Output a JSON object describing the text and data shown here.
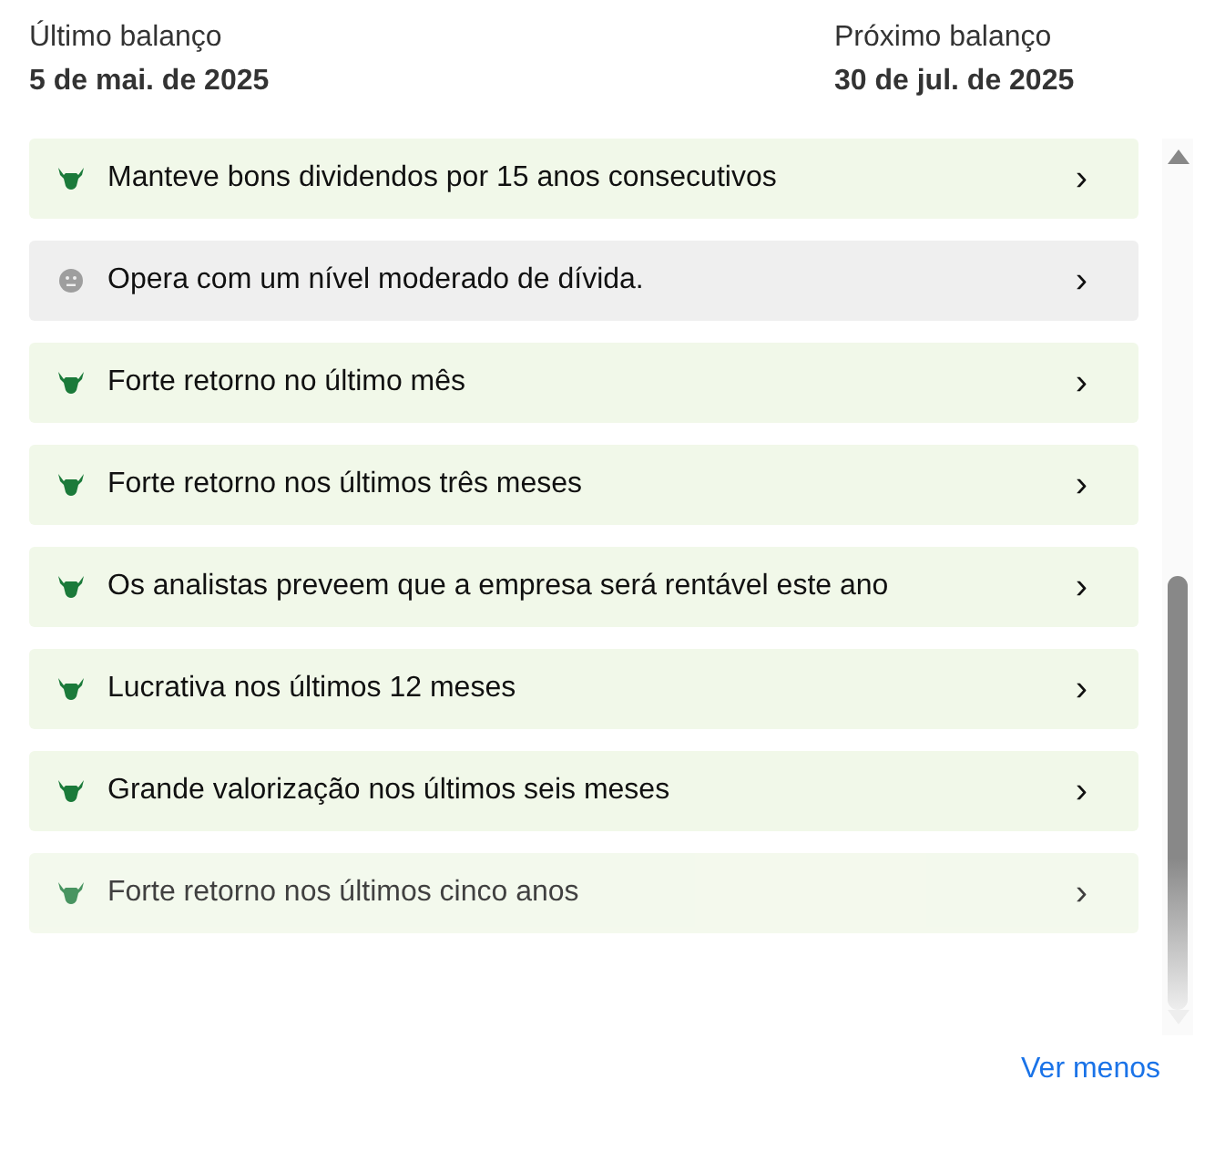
{
  "last_earnings": {
    "label": "Último balanço",
    "date": "5 de mai. de 2025"
  },
  "next_earnings": {
    "label": "Próximo balanço",
    "date": "30 de jul. de 2025"
  },
  "insights": [
    {
      "kind": "bull",
      "text": "Manteve bons dividendos por 15 anos consecutivos",
      "chevron": "›"
    },
    {
      "kind": "neutral",
      "text": "Opera com um nível moderado de dívida.",
      "chevron": "›"
    },
    {
      "kind": "bull",
      "text": "Forte retorno no último mês",
      "chevron": "›"
    },
    {
      "kind": "bull",
      "text": "Forte retorno nos últimos três meses",
      "chevron": "›"
    },
    {
      "kind": "bull",
      "text": "Os analistas preveem que a empresa será rentável este ano",
      "chevron": "›"
    },
    {
      "kind": "bull",
      "text": "Lucrativa nos últimos 12 meses",
      "chevron": "›"
    },
    {
      "kind": "bull",
      "text": "Grande valorização nos últimos seis meses",
      "chevron": "›"
    },
    {
      "kind": "bull",
      "text": "Forte retorno nos últimos cinco anos",
      "chevron": "›"
    }
  ],
  "toggle_link": "Ver menos"
}
